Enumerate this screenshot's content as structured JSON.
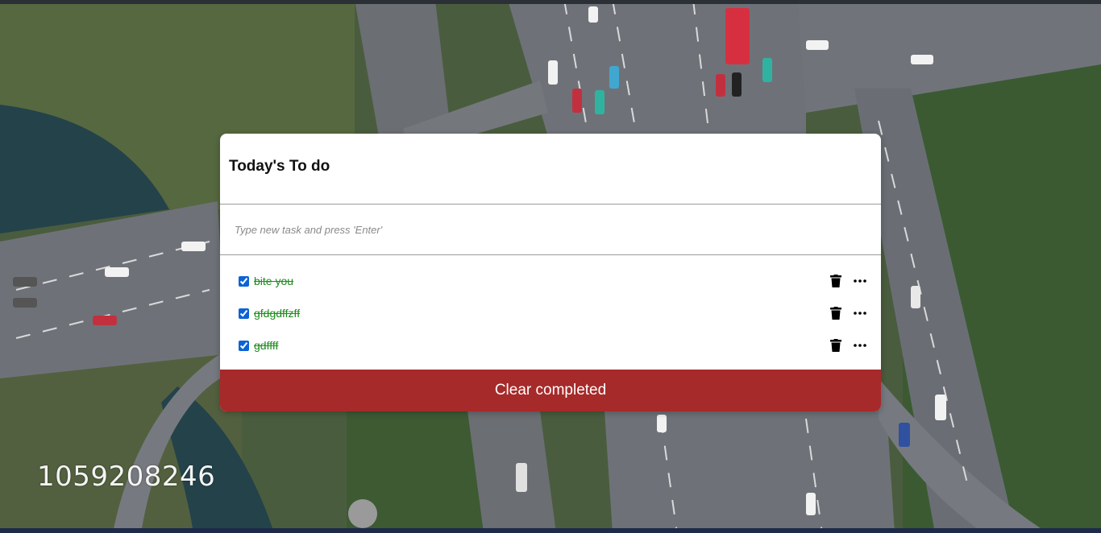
{
  "background": {
    "watermark": "1059208246",
    "colors": {
      "road": "#6e7278",
      "foliage": "#3f5a35",
      "water": "#24424a",
      "lane": "#d9d9d9"
    }
  },
  "todo": {
    "title": "Today's To do",
    "new_task_placeholder": "Type new task and press 'Enter'",
    "new_task_value": "",
    "tasks": [
      {
        "label": "bite you",
        "completed": true
      },
      {
        "label": "gfdgdffzff",
        "completed": true
      },
      {
        "label": "gdffff",
        "completed": true
      }
    ],
    "task_icons": [
      "trash-icon",
      "more-horizontal-icon"
    ],
    "clear_completed_label": "Clear completed",
    "colors": {
      "completed_text": "#1e8a1e",
      "clear_button": "#a62a2a",
      "checkbox": "#0b63d6"
    }
  }
}
